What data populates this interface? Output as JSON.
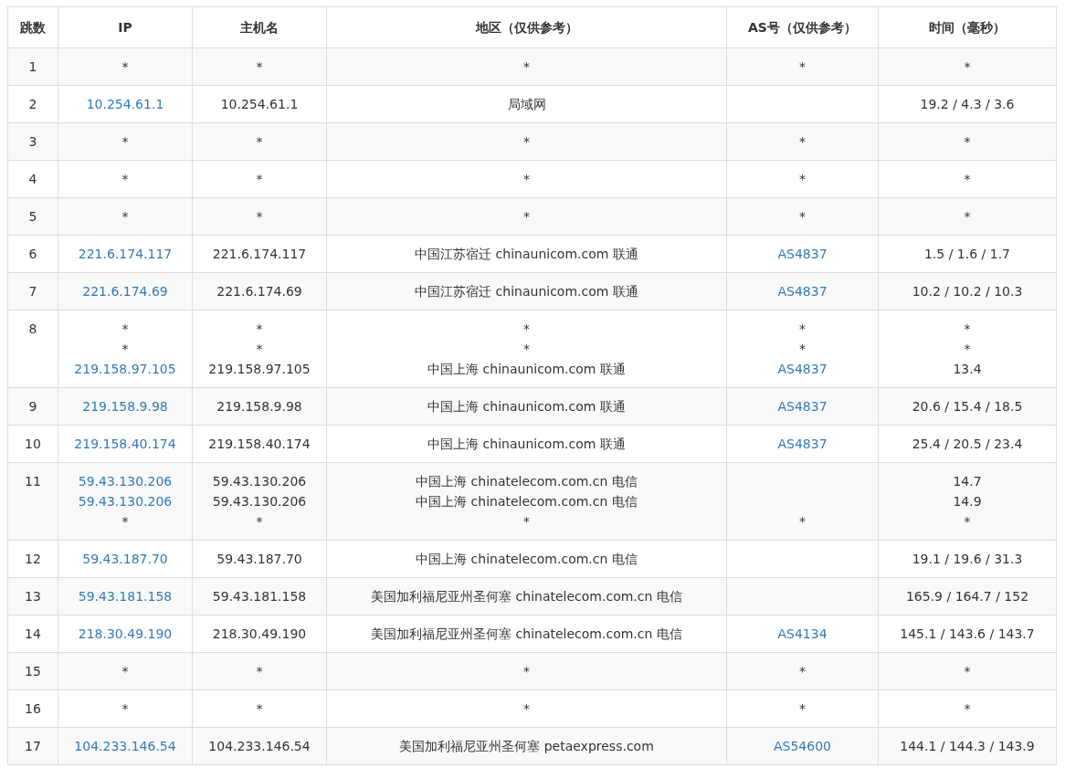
{
  "table": {
    "columns": [
      "跳数",
      "IP",
      "主机名",
      "地区（仅供参考）",
      "AS号（仅供参考）",
      "时间（毫秒）"
    ],
    "rows": [
      {
        "hop": "1",
        "probes": [
          {
            "ip": "*",
            "host": "*",
            "region": "*",
            "as": "*",
            "time": "*"
          }
        ]
      },
      {
        "hop": "2",
        "probes": [
          {
            "ip": "10.254.61.1",
            "host": "10.254.61.1",
            "region": "局域网",
            "time": "19.2 / 4.3 / 3.6"
          }
        ]
      },
      {
        "hop": "3",
        "probes": [
          {
            "ip": "*",
            "host": "*",
            "region": "*",
            "as": "*",
            "time": "*"
          }
        ]
      },
      {
        "hop": "4",
        "probes": [
          {
            "ip": "*",
            "host": "*",
            "region": "*",
            "as": "*",
            "time": "*"
          }
        ]
      },
      {
        "hop": "5",
        "probes": [
          {
            "ip": "*",
            "host": "*",
            "region": "*",
            "as": "*",
            "time": "*"
          }
        ]
      },
      {
        "hop": "6",
        "probes": [
          {
            "ip": "221.6.174.117",
            "host": "221.6.174.117",
            "region": "中国江苏宿迁 chinaunicom.com 联通",
            "as": "AS4837",
            "time": "1.5 / 1.6 / 1.7"
          }
        ]
      },
      {
        "hop": "7",
        "probes": [
          {
            "ip": "221.6.174.69",
            "host": "221.6.174.69",
            "region": "中国江苏宿迁 chinaunicom.com 联通",
            "as": "AS4837",
            "time": "10.2 / 10.2 / 10.3"
          }
        ]
      },
      {
        "hop": "8",
        "probes": [
          {
            "ip": "*",
            "host": "*",
            "region": "*",
            "as": "*",
            "time": "*"
          },
          {
            "ip": "*",
            "host": "*",
            "region": "*",
            "as": "*",
            "time": "*"
          },
          {
            "ip": "219.158.97.105",
            "host": "219.158.97.105",
            "region": "中国上海 chinaunicom.com 联通",
            "as": "AS4837",
            "time": "13.4"
          }
        ]
      },
      {
        "hop": "9",
        "probes": [
          {
            "ip": "219.158.9.98",
            "host": "219.158.9.98",
            "region": "中国上海 chinaunicom.com 联通",
            "as": "AS4837",
            "time": "20.6 / 15.4 / 18.5"
          }
        ]
      },
      {
        "hop": "10",
        "probes": [
          {
            "ip": "219.158.40.174",
            "host": "219.158.40.174",
            "region": "中国上海 chinaunicom.com 联通",
            "as": "AS4837",
            "time": "25.4 / 20.5 / 23.4"
          }
        ]
      },
      {
        "hop": "11",
        "probes": [
          {
            "ip": "59.43.130.206",
            "host": "59.43.130.206",
            "region": "中国上海 chinatelecom.com.cn 电信",
            "time": "14.7"
          },
          {
            "ip": "59.43.130.206",
            "host": "59.43.130.206",
            "region": "中国上海 chinatelecom.com.cn 电信",
            "time": "14.9"
          },
          {
            "ip": "*",
            "host": "*",
            "region": "*",
            "as": "*",
            "time": "*"
          }
        ]
      },
      {
        "hop": "12",
        "probes": [
          {
            "ip": "59.43.187.70",
            "host": "59.43.187.70",
            "region": "中国上海 chinatelecom.com.cn 电信",
            "time": "19.1 / 19.6 / 31.3"
          }
        ]
      },
      {
        "hop": "13",
        "probes": [
          {
            "ip": "59.43.181.158",
            "host": "59.43.181.158",
            "region": "美国加利福尼亚州圣何塞 chinatelecom.com.cn 电信",
            "time": "165.9 / 164.7 / 152"
          }
        ]
      },
      {
        "hop": "14",
        "probes": [
          {
            "ip": "218.30.49.190",
            "host": "218.30.49.190",
            "region": "美国加利福尼亚州圣何塞 chinatelecom.com.cn 电信",
            "as": "AS4134",
            "time": "145.1 / 143.6 / 143.7"
          }
        ]
      },
      {
        "hop": "15",
        "probes": [
          {
            "ip": "*",
            "host": "*",
            "region": "*",
            "as": "*",
            "time": "*"
          }
        ]
      },
      {
        "hop": "16",
        "probes": [
          {
            "ip": "*",
            "host": "*",
            "region": "*",
            "as": "*",
            "time": "*"
          }
        ]
      },
      {
        "hop": "17",
        "probes": [
          {
            "ip": "104.233.146.54",
            "host": "104.233.146.54",
            "region": "美国加利福尼亚州圣何塞 petaexpress.com",
            "as": "AS54600",
            "time": "144.1 / 144.3 / 143.9"
          }
        ]
      }
    ]
  }
}
